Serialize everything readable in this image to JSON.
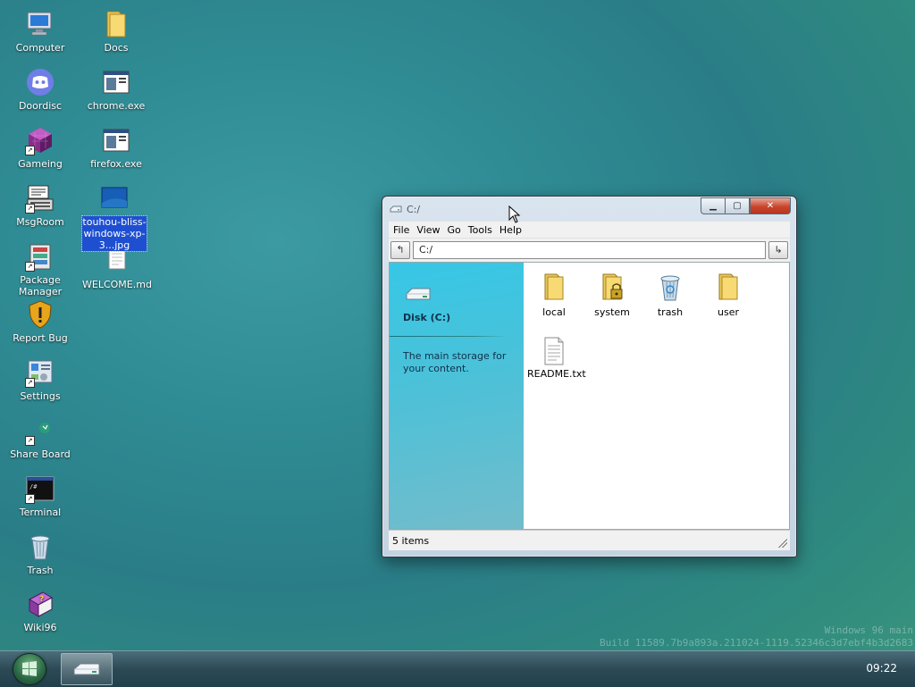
{
  "desktop": {
    "icons": [
      {
        "label": "Computer"
      },
      {
        "label": "Doordisc"
      },
      {
        "label": "Gameing"
      },
      {
        "label": "MsgRoom"
      },
      {
        "label": "Package Manager"
      },
      {
        "label": "Report Bug"
      },
      {
        "label": "Settings"
      },
      {
        "label": "Share Board"
      },
      {
        "label": "Terminal"
      },
      {
        "label": "Trash"
      },
      {
        "label": "Wiki96"
      },
      {
        "label": "Docs"
      },
      {
        "label": "chrome.exe"
      },
      {
        "label": "firefox.exe"
      },
      {
        "label": "touhou-bliss-windows-xp-3...jpg"
      },
      {
        "label": "WELCOME.md"
      }
    ]
  },
  "window": {
    "title": "C:/",
    "menu": [
      "File",
      "View",
      "Go",
      "Tools",
      "Help"
    ],
    "up_button": "↰",
    "address": "C:/",
    "go_button": "↳",
    "sidebar": {
      "disk_name": "Disk (C:)",
      "description": "The main storage for your content."
    },
    "files": [
      {
        "name": "local",
        "icon": "folder-icon"
      },
      {
        "name": "system",
        "icon": "locked-folder-icon"
      },
      {
        "name": "trash",
        "icon": "recycle-bin-icon"
      },
      {
        "name": "user",
        "icon": "folder-icon"
      },
      {
        "name": "README.txt",
        "icon": "text-file-icon"
      }
    ],
    "status": "5 items"
  },
  "watermark": {
    "line1": "Windows 96 main",
    "line2": "Build 11589.7b9a893a.211024-1119.52346c3d7ebf4b3d2683"
  },
  "taskbar": {
    "clock": "09:22"
  }
}
